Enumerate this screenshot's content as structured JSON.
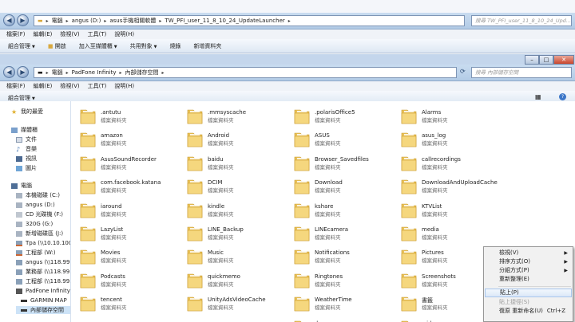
{
  "back_window": {
    "breadcrumb": [
      "電腦",
      "angus (D:)",
      "asus手機相關軟體",
      "TW_PFI_user_11_8_10_24_UpdateLauncher"
    ],
    "search_placeholder": "搜尋 TW_PFI_user_11_8_10_24_Upd...",
    "menu": [
      "檔案(F)",
      "編輯(E)",
      "檢視(V)",
      "工具(T)",
      "說明(H)"
    ],
    "toolbar": [
      "組合管理",
      "開啟",
      "加入至媒體櫃",
      "共用對象",
      "燒錄",
      "新增資料夾"
    ]
  },
  "front_window": {
    "breadcrumb": [
      "電腦",
      "PadFone Infinity",
      "內部儲存空間"
    ],
    "search_placeholder": "搜尋 內部儲存空間",
    "menu": [
      "檔案(F)",
      "編輯(E)",
      "檢視(V)",
      "工具(T)",
      "說明(H)"
    ],
    "toolbar": [
      "組合管理"
    ]
  },
  "sidebar": {
    "items": [
      "我的最愛",
      "媒體櫃",
      "文件",
      "音樂",
      "視訊",
      "圖片",
      "電腦",
      "本機磁碟 (C:)",
      "angus (D:)",
      "CD 光碟機 (F:)",
      "320G (G:)",
      "新增磁碟區 (J:)",
      "Tpa (\\\\10.10.100.10",
      "工程部 (W:)",
      "angus (\\\\118.99.19",
      "業務部 (\\\\118.99.19",
      "工程部 (\\\\118.99.19",
      "PadFone Infinity",
      "GARMIN MAP",
      "內部儲存空間"
    ]
  },
  "folder_type": "檔案資料夾",
  "files": [
    [
      ".antutu",
      ".mmsyscache",
      ".polarisOffice5",
      "Alarms"
    ],
    [
      "amazon",
      "Android",
      "ASUS",
      "asus_log"
    ],
    [
      "AsusSoundRecorder",
      "baidu",
      "Browser_Savedfiles",
      "callrecordings"
    ],
    [
      "com.facebook.katana",
      "DCIM",
      "Download",
      "DownloadAndUploadCache"
    ],
    [
      "iaround",
      "kindle",
      "kshare",
      "KTVList"
    ],
    [
      "LazyList",
      "LINE_Backup",
      "LINEcamera",
      "media"
    ],
    [
      "Movies",
      "Music",
      "Notifications",
      "Pictures"
    ],
    [
      "Podcasts",
      "quickmemo",
      "Ringtones",
      "Screenshots"
    ],
    [
      "tencent",
      "UnityAdsVideoCache",
      "WeatherTime",
      "書籤"
    ],
    [
      "",
      "",
      ".busreone",
      ".cid"
    ]
  ],
  "context_menu": {
    "view": "檢視(V)",
    "sort": "排序方式(O)",
    "group": "分組方式(P)",
    "refresh": "重新整理(E)",
    "paste": "貼上(P)",
    "paste_shortcut": "貼上捷徑(S)",
    "undo": "復原 重新命名(U)",
    "undo_shortcut": "Ctrl+Z"
  }
}
